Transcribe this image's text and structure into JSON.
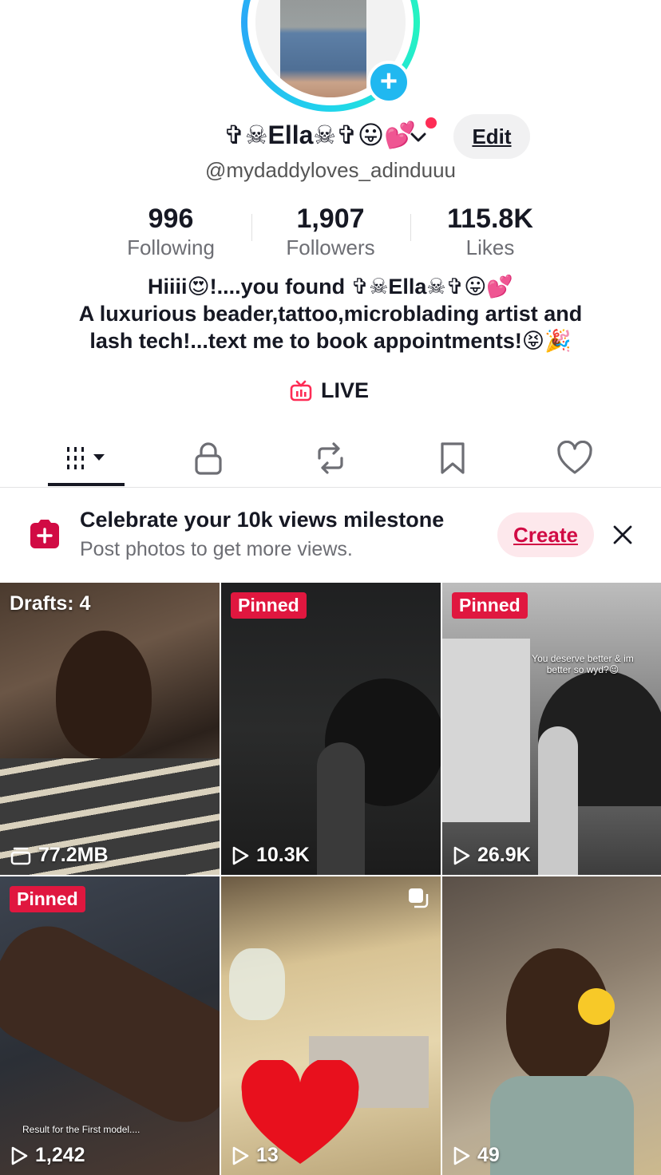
{
  "profile": {
    "name": "✞☠Ella☠✞😛💕",
    "handle": "@mydaddyloves_adinduuu",
    "edit_label": "Edit"
  },
  "stats": [
    {
      "value": "996",
      "label": "Following"
    },
    {
      "value": "1,907",
      "label": "Followers"
    },
    {
      "value": "115.8K",
      "label": "Likes"
    }
  ],
  "bio": {
    "line1": "Hiiii😍!....you found ✞☠Ella☠✞😛💕",
    "line2": "A luxurious beader,tattoo,microblading artist and",
    "line3": "lash tech!...text me to book appointments!😝🎉"
  },
  "live": {
    "label": "LIVE"
  },
  "tabs": [
    {
      "icon": "grid-icon"
    },
    {
      "icon": "lock-icon"
    },
    {
      "icon": "repost-icon"
    },
    {
      "icon": "bookmark-icon"
    },
    {
      "icon": "heart-icon"
    }
  ],
  "banner": {
    "title": "Celebrate your 10k views milestone",
    "subtitle": "Post photos to get more views.",
    "create_label": "Create"
  },
  "grid": [
    {
      "badge": "",
      "drafts": "Drafts: 4",
      "count": "77.2MB",
      "count_icon": "drafts-icon"
    },
    {
      "badge": "Pinned",
      "count": "10.3K",
      "count_icon": "play-icon"
    },
    {
      "badge": "Pinned",
      "count": "26.9K",
      "count_icon": "play-icon",
      "overlay": "You deserve better & im better so wyd?😉"
    },
    {
      "badge": "Pinned",
      "count": "1,242",
      "count_icon": "play-icon",
      "overlay": "Result for the First model...."
    },
    {
      "badge": "",
      "count": "13",
      "count_icon": "play-icon"
    },
    {
      "badge": "",
      "count": "49",
      "count_icon": "play-icon"
    }
  ],
  "colors": {
    "accent": "#fe2c55",
    "pinned": "#e0173f",
    "ring": "#20d5ec"
  }
}
